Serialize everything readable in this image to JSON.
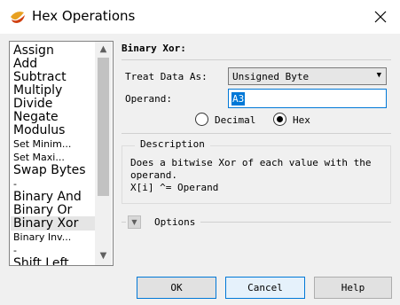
{
  "window": {
    "title": "Hex Operations",
    "close_label": "close"
  },
  "operations": [
    {
      "label": "Assign",
      "size": "big"
    },
    {
      "label": "Add",
      "size": "big"
    },
    {
      "label": "Subtract",
      "size": "big"
    },
    {
      "label": "Multiply",
      "size": "big"
    },
    {
      "label": "Divide",
      "size": "big"
    },
    {
      "label": "Negate",
      "size": "big"
    },
    {
      "label": "Modulus",
      "size": "big"
    },
    {
      "label": "Set Minim...",
      "size": "small"
    },
    {
      "label": "Set Maxi...",
      "size": "small"
    },
    {
      "label": "Swap Bytes",
      "size": "big"
    },
    {
      "label": "-",
      "size": "small"
    },
    {
      "label": "Binary And",
      "size": "big"
    },
    {
      "label": "Binary Or",
      "size": "big"
    },
    {
      "label": "Binary Xor",
      "size": "big",
      "selected": true
    },
    {
      "label": "Binary Inv...",
      "size": "small"
    },
    {
      "label": "-",
      "size": "small"
    },
    {
      "label": "Shift Left",
      "size": "big"
    }
  ],
  "panel": {
    "section_title": "Binary Xor:",
    "treat_label": "Treat Data As:",
    "treat_value": "Unsigned Byte",
    "operand_label": "Operand:",
    "operand_value": "A3",
    "radio_decimal": "Decimal",
    "radio_hex": "Hex",
    "radio_selected": "hex",
    "description_title": "Description",
    "description_lines": [
      "Does a bitwise Xor of each value with the",
      "operand.",
      "X[i] ^= Operand"
    ],
    "options_label": "Options"
  },
  "buttons": {
    "ok": "OK",
    "cancel": "Cancel",
    "help": "Help"
  }
}
